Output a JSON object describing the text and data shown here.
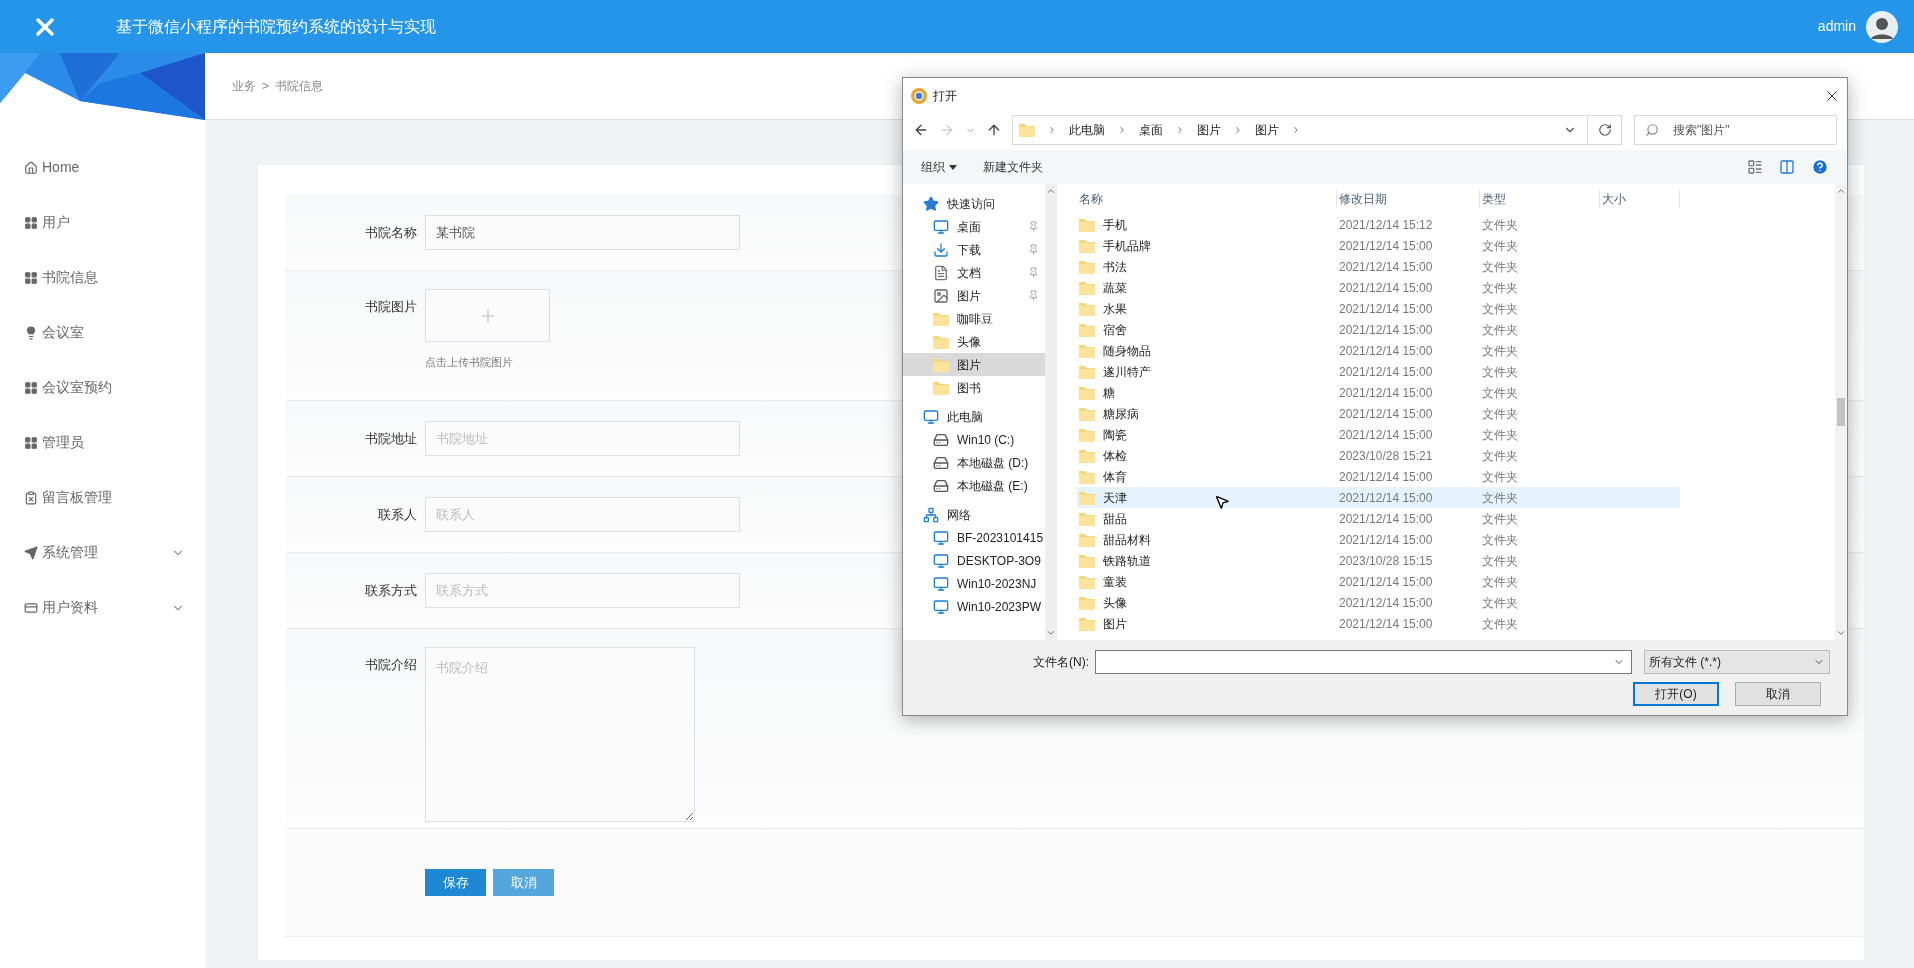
{
  "header": {
    "title": "基于微信小程序的书院预约系统的设计与实现",
    "user": "admin"
  },
  "sidebar": {
    "items": [
      {
        "label": "Home",
        "kind": "home",
        "expandable": false
      },
      {
        "label": "用户",
        "kind": "grid",
        "expandable": false
      },
      {
        "label": "书院信息",
        "kind": "grid",
        "expandable": false
      },
      {
        "label": "会议室",
        "kind": "bulb",
        "expandable": false
      },
      {
        "label": "会议室预约",
        "kind": "grid",
        "expandable": false
      },
      {
        "label": "管理员",
        "kind": "grid",
        "expandable": false
      },
      {
        "label": "留言板管理",
        "kind": "clipboard",
        "expandable": false
      },
      {
        "label": "系统管理",
        "kind": "send",
        "expandable": true
      },
      {
        "label": "用户资料",
        "kind": "card",
        "expandable": true
      }
    ]
  },
  "breadcrumb": {
    "items": [
      "业务",
      "书院信息"
    ],
    "separator": ">"
  },
  "form": {
    "fields": [
      {
        "kind": "text",
        "label": "书院名称",
        "value": "某书院"
      },
      {
        "kind": "upload",
        "label": "书院图片",
        "hint": "点击上传书院图片"
      },
      {
        "kind": "text",
        "label": "书院地址",
        "placeholder": "书院地址"
      },
      {
        "kind": "text",
        "label": "联系人",
        "placeholder": "联系人"
      },
      {
        "kind": "text",
        "label": "联系方式",
        "placeholder": "联系方式"
      },
      {
        "kind": "textarea",
        "label": "书院介绍",
        "placeholder": "书院介绍"
      }
    ],
    "buttons": [
      {
        "label": "保存",
        "kind": "primary"
      },
      {
        "label": "取消",
        "kind": "secondary"
      }
    ]
  },
  "dialog": {
    "title": "打开",
    "path": [
      "此电脑",
      "桌面",
      "图片",
      "图片"
    ],
    "search": {
      "placeholder": "搜索\"图片\""
    },
    "toolbar": [
      {
        "label": "组织",
        "dropdown": true
      },
      {
        "label": "新建文件夹",
        "dropdown": false
      }
    ],
    "nav": [
      {
        "label": "快速访问",
        "kind": "star",
        "selected": false,
        "children": [
          {
            "label": "桌面",
            "kind": "desktop",
            "pinned": true,
            "selected": false
          },
          {
            "label": "下载",
            "kind": "download",
            "pinned": true,
            "selected": false
          },
          {
            "label": "文档",
            "kind": "document",
            "pinned": true,
            "selected": false
          },
          {
            "label": "图片",
            "kind": "image",
            "pinned": true,
            "selected": false
          },
          {
            "label": "咖啡豆",
            "kind": "folder",
            "pinned": false,
            "selected": false
          },
          {
            "label": "头像",
            "kind": "folder",
            "pinned": false,
            "selected": false
          },
          {
            "label": "图片",
            "kind": "folder",
            "pinned": false,
            "selected": true
          },
          {
            "label": "图书",
            "kind": "folder",
            "pinned": false,
            "selected": false
          }
        ]
      },
      {
        "label": "此电脑",
        "kind": "computer",
        "selected": false,
        "children": [
          {
            "label": "Win10 (C:)",
            "kind": "drive",
            "pinned": false,
            "selected": false
          },
          {
            "label": "本地磁盘 (D:)",
            "kind": "drive",
            "pinned": false,
            "selected": false
          },
          {
            "label": "本地磁盘 (E:)",
            "kind": "drive",
            "pinned": false,
            "selected": false
          }
        ]
      },
      {
        "label": "网络",
        "kind": "network",
        "selected": false,
        "children": [
          {
            "label": "BF-2023101415",
            "kind": "computer",
            "pinned": false,
            "selected": false
          },
          {
            "label": "DESKTOP-3O9",
            "kind": "computer",
            "pinned": false,
            "selected": false
          },
          {
            "label": "Win10-2023NJ",
            "kind": "computer",
            "pinned": false,
            "selected": false
          },
          {
            "label": "Win10-2023PW",
            "kind": "computer",
            "pinned": false,
            "selected": false
          }
        ]
      }
    ],
    "columns": [
      "名称",
      "修改日期",
      "类型",
      "大小"
    ],
    "rows": [
      {
        "name": "手机",
        "date": "2021/12/14 15:12",
        "type": "文件夹",
        "hovered": false
      },
      {
        "name": "手机品牌",
        "date": "2021/12/14 15:00",
        "type": "文件夹",
        "hovered": false
      },
      {
        "name": "书法",
        "date": "2021/12/14 15:00",
        "type": "文件夹",
        "hovered": false
      },
      {
        "name": "蔬菜",
        "date": "2021/12/14 15:00",
        "type": "文件夹",
        "hovered": false
      },
      {
        "name": "水果",
        "date": "2021/12/14 15:00",
        "type": "文件夹",
        "hovered": false
      },
      {
        "name": "宿舍",
        "date": "2021/12/14 15:00",
        "type": "文件夹",
        "hovered": false
      },
      {
        "name": "随身物品",
        "date": "2021/12/14 15:00",
        "type": "文件夹",
        "hovered": false
      },
      {
        "name": "遂川特产",
        "date": "2021/12/14 15:00",
        "type": "文件夹",
        "hovered": false
      },
      {
        "name": "糖",
        "date": "2021/12/14 15:00",
        "type": "文件夹",
        "hovered": false
      },
      {
        "name": "糖尿病",
        "date": "2021/12/14 15:00",
        "type": "文件夹",
        "hovered": false
      },
      {
        "name": "陶瓷",
        "date": "2021/12/14 15:00",
        "type": "文件夹",
        "hovered": false
      },
      {
        "name": "体检",
        "date": "2023/10/28 15:21",
        "type": "文件夹",
        "hovered": false
      },
      {
        "name": "体育",
        "date": "2021/12/14 15:00",
        "type": "文件夹",
        "hovered": false
      },
      {
        "name": "天津",
        "date": "2021/12/14 15:00",
        "type": "文件夹",
        "hovered": true
      },
      {
        "name": "甜品",
        "date": "2021/12/14 15:00",
        "type": "文件夹",
        "hovered": false
      },
      {
        "name": "甜品材料",
        "date": "2021/12/14 15:00",
        "type": "文件夹",
        "hovered": false
      },
      {
        "name": "铁路轨道",
        "date": "2023/10/28 15:15",
        "type": "文件夹",
        "hovered": false
      },
      {
        "name": "童装",
        "date": "2021/12/14 15:00",
        "type": "文件夹",
        "hovered": false
      },
      {
        "name": "头像",
        "date": "2021/12/14 15:00",
        "type": "文件夹",
        "hovered": false
      },
      {
        "name": "图片",
        "date": "2021/12/14 15:00",
        "type": "文件夹",
        "hovered": false
      }
    ],
    "filename": {
      "label": "文件名(N):"
    },
    "filter": "所有文件 (*.*)",
    "buttons": [
      {
        "label": "打开(O)",
        "default": true
      },
      {
        "label": "取消",
        "default": false
      }
    ]
  }
}
